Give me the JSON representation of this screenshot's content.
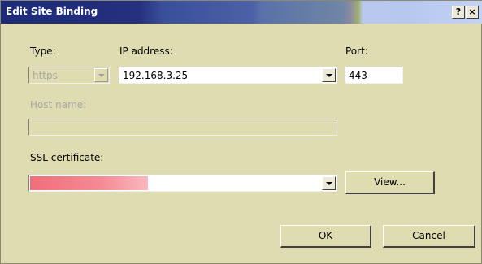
{
  "window": {
    "title": "Edit Site Binding",
    "help_button": "?",
    "close_button": "×"
  },
  "type": {
    "label": "Type:",
    "value": "https"
  },
  "ip_address": {
    "label": "IP address:",
    "value": "192.168.3.25"
  },
  "port": {
    "label": "Port:",
    "value": "443"
  },
  "host_name": {
    "label": "Host name:",
    "value": ""
  },
  "ssl_certificate": {
    "label": "SSL certificate:",
    "value": ""
  },
  "buttons": {
    "view": "View...",
    "ok": "OK",
    "cancel": "Cancel"
  },
  "colors": {
    "dialog_background": "#dedcb0",
    "title_text": "#ffffff",
    "disabled_text": "#a8a8a8",
    "redaction": "#f06e7a"
  }
}
